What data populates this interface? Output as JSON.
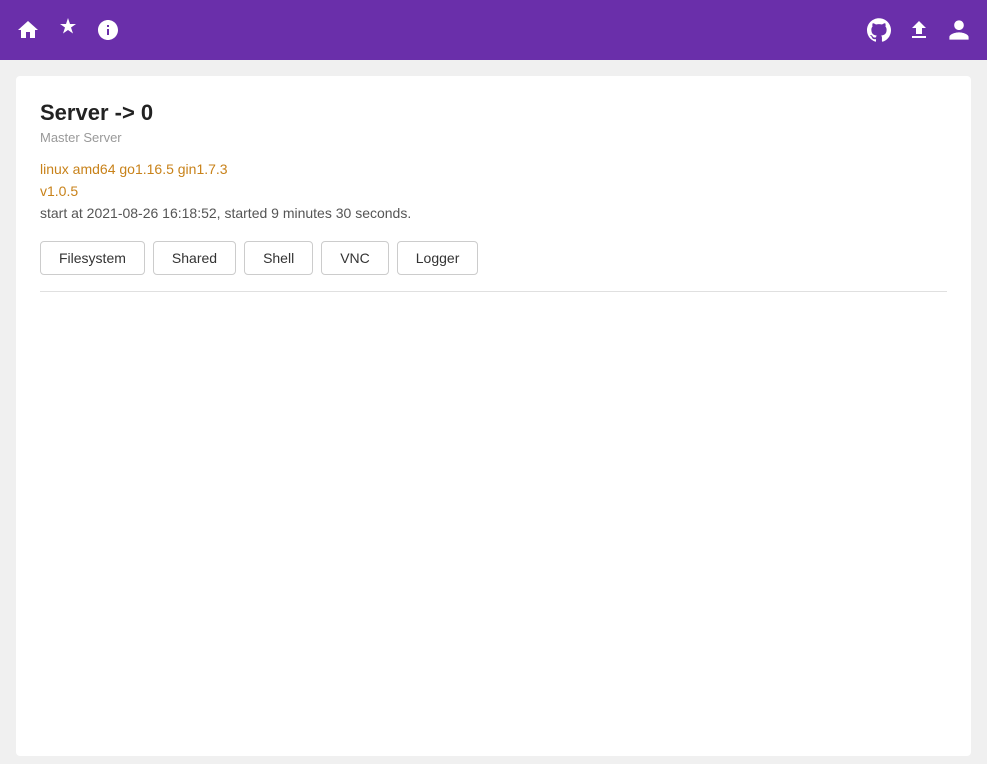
{
  "header": {
    "background_color": "#6a2faa",
    "nav_left": [
      {
        "name": "home-icon",
        "symbol": "🏠"
      },
      {
        "name": "star-icon",
        "symbol": "✳"
      },
      {
        "name": "info-icon",
        "symbol": "ℹ"
      }
    ],
    "nav_right": [
      {
        "name": "github-icon",
        "symbol": "⊙"
      },
      {
        "name": "upload-icon",
        "symbol": "⬆"
      },
      {
        "name": "account-icon",
        "symbol": "👤"
      }
    ]
  },
  "server": {
    "title": "Server -> 0",
    "subtitle": "Master Server",
    "info_line": "linux amd64 go1.16.5 gin1.7.3",
    "version": "v1.0.5",
    "uptime": "start at 2021-08-26 16:18:52, started 9 minutes 30 seconds."
  },
  "buttons": [
    {
      "label": "Filesystem",
      "name": "filesystem-button"
    },
    {
      "label": "Shared",
      "name": "shared-button"
    },
    {
      "label": "Shell",
      "name": "shell-button"
    },
    {
      "label": "VNC",
      "name": "vnc-button"
    },
    {
      "label": "Logger",
      "name": "logger-button"
    }
  ]
}
